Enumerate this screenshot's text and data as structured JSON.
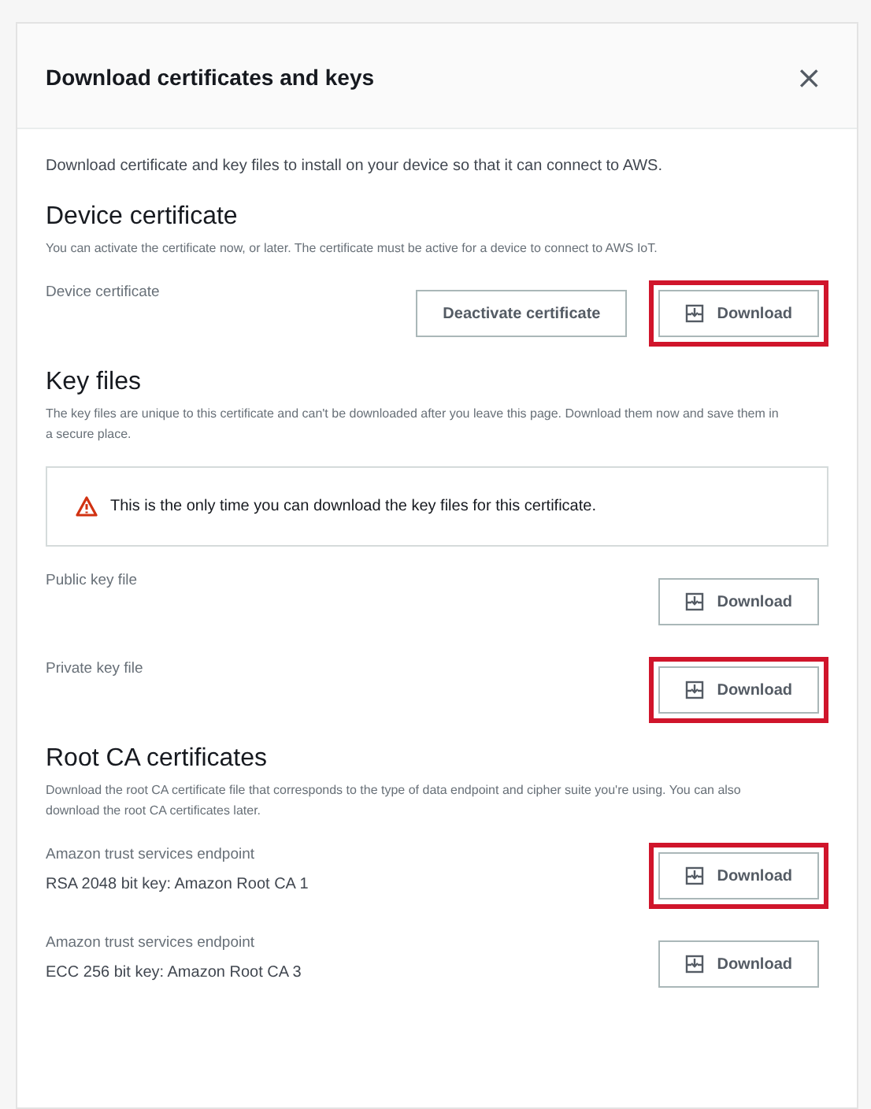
{
  "dialog": {
    "title": "Download certificates and keys",
    "close": "×",
    "intro": "Download certificate and key files to install on your device so that it can connect to AWS."
  },
  "sections": [
    {
      "heading": "Device certificate",
      "description": "You can activate the certificate now, or later. The certificate must be active for a device to connect to AWS IoT.",
      "rows": [
        {
          "label": "Device certificate",
          "actions": [
            {
              "kind": "plain",
              "label": "Deactivate certificate",
              "highlighted": false
            },
            {
              "kind": "download",
              "label": "Download",
              "highlighted": true
            }
          ]
        }
      ]
    },
    {
      "heading": "Key files",
      "description": "The key files are unique to this certificate and can't be downloaded after you leave this page. Download them now and save them in a secure place.",
      "alert": "This is the only time you can download the key files for this certificate.",
      "rows": [
        {
          "label": "Public key file",
          "actions": [
            {
              "kind": "download",
              "label": "Download",
              "highlighted": false
            }
          ]
        },
        {
          "label": "Private key file",
          "actions": [
            {
              "kind": "download",
              "label": "Download",
              "highlighted": true
            }
          ]
        }
      ]
    },
    {
      "heading": "Root CA certificates",
      "description": "Download the root CA certificate file that corresponds to the type of data endpoint and cipher suite you're using. You can also download the root CA certificates later.",
      "rows": [
        {
          "label": "Amazon trust services endpoint",
          "detail": "RSA 2048 bit key: Amazon Root CA 1",
          "actions": [
            {
              "kind": "download",
              "label": "Download",
              "highlighted": true
            }
          ]
        },
        {
          "label": "Amazon trust services endpoint",
          "detail": "ECC 256 bit key: Amazon Root CA 3",
          "actions": [
            {
              "kind": "download",
              "label": "Download",
              "highlighted": false
            }
          ]
        }
      ]
    }
  ]
}
